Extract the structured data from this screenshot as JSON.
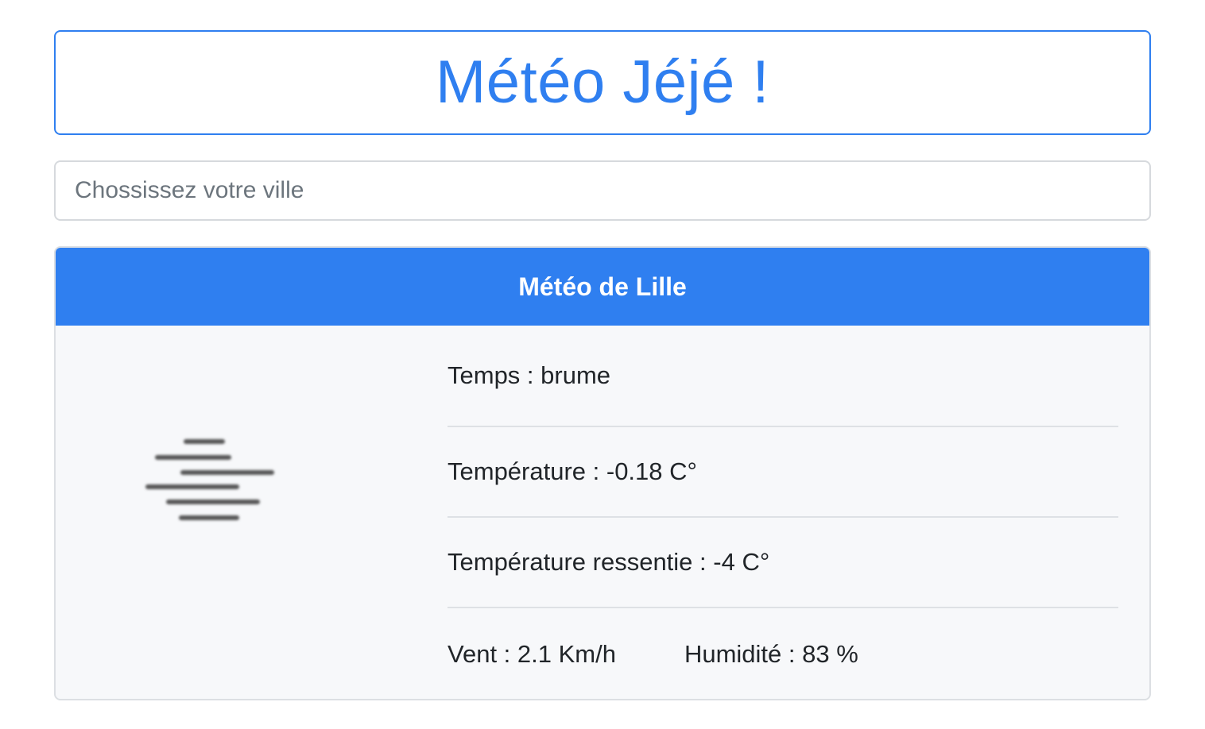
{
  "header": {
    "title": "Météo Jéjé !"
  },
  "search": {
    "placeholder": "Chossissez votre ville",
    "value": ""
  },
  "weather_card": {
    "title": "Météo de Lille",
    "icon": "mist-icon",
    "weather": "Temps : brume",
    "temperature": "Température : -0.18 C°",
    "feels_like": "Température ressentie : -4 C°",
    "wind": "Vent : 2.1 Km/h",
    "humidity": "Humidité : 83 %"
  },
  "colors": {
    "accent": "#2f7ff0",
    "card_background": "#f7f8fa",
    "mist_icon": "#555555"
  }
}
